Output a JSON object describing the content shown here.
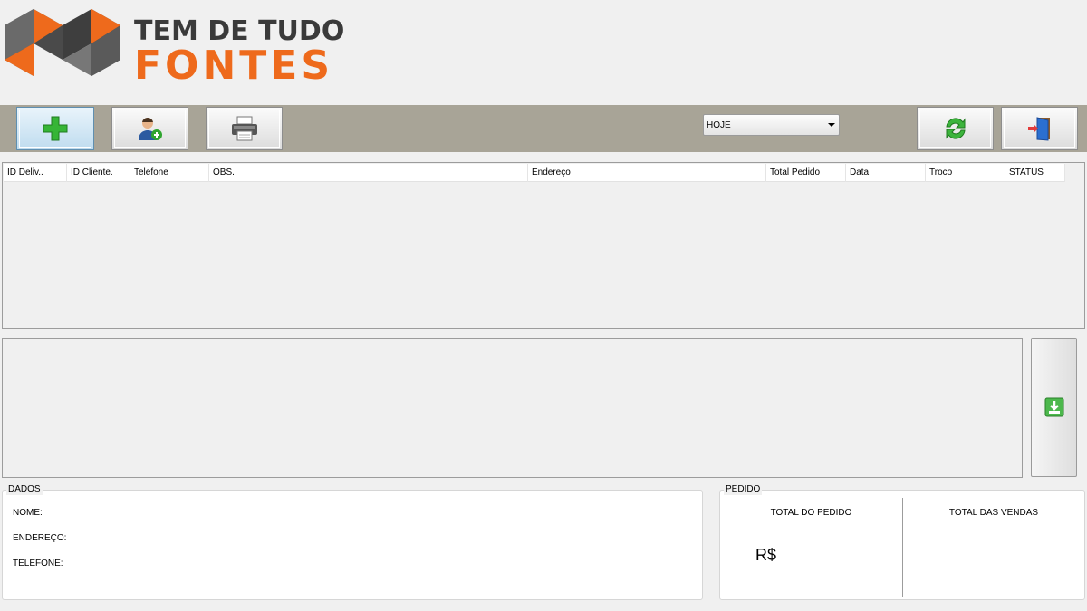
{
  "logo": {
    "line1": "TEM DE TUDO",
    "line2": "FONTES",
    "icon": "brand-logo-icon"
  },
  "toolbar": {
    "buttons": [
      {
        "name": "add-delivery-button",
        "icon": "plus-icon"
      },
      {
        "name": "add-client-button",
        "icon": "user-add-icon"
      },
      {
        "name": "print-button",
        "icon": "printer-icon"
      },
      {
        "name": "refresh-button",
        "icon": "refresh-icon"
      },
      {
        "name": "exit-button",
        "icon": "exit-door-icon"
      }
    ],
    "period_select": {
      "value": "HOJE"
    }
  },
  "grid": {
    "columns": [
      "ID Deliv..",
      "ID Cliente.",
      "Telefone",
      "OBS.",
      "Endereço",
      "Total Pedido",
      "Data",
      "Troco",
      "STATUS"
    ],
    "rows": []
  },
  "side_button": {
    "icon": "download-icon"
  },
  "dados": {
    "title": "DADOS",
    "nome_label": "NOME:",
    "endereco_label": "ENDEREÇO:",
    "telefone_label": "TELEFONE:"
  },
  "pedido": {
    "title": "PEDIDO",
    "total_pedido_label": "TOTAL DO PEDIDO",
    "total_vendas_label": "TOTAL DAS VENDAS",
    "currency": "R$"
  },
  "colors": {
    "orange": "#ee6a1c",
    "toolbar": "#a8a497",
    "green": "#2fa52f"
  }
}
